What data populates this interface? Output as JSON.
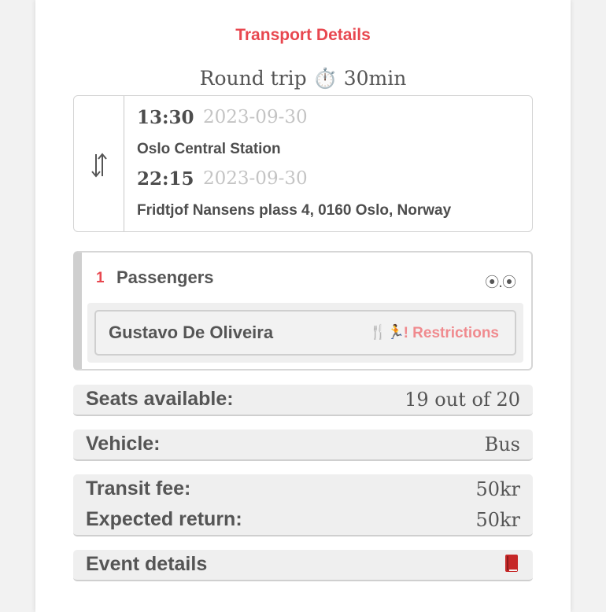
{
  "header": {
    "title": "Transport Details"
  },
  "trip": {
    "summary": "Round trip ⏱️ 30min",
    "departure": {
      "time": "13:30",
      "date": "2023-09-30",
      "location": "Oslo Central Station"
    },
    "return": {
      "time": "22:15",
      "date": "2023-09-30",
      "location": "Fridtjof Nansens plass 4, 0160 Oslo, Norway"
    }
  },
  "passengers": {
    "count": "1",
    "label": "Passengers",
    "menu_icon": "⦿.⦿",
    "items": [
      {
        "name": "Gustavo De Oliveira",
        "restriction_icons": "🍴🏃",
        "restriction_label": "! Restrictions"
      }
    ]
  },
  "seats": {
    "label": "Seats available:",
    "value": "19 out of 20"
  },
  "vehicle": {
    "label": "Vehicle:",
    "value": "Bus"
  },
  "fees": {
    "transit_label": "Transit fee:",
    "transit_value": "50kr",
    "return_label": "Expected return:",
    "return_value": "50kr"
  },
  "event": {
    "label": "Event details",
    "icon": "book-icon"
  },
  "colors": {
    "accent": "#e8474f",
    "restriction": "#f08a8e",
    "book": "#c62828"
  }
}
